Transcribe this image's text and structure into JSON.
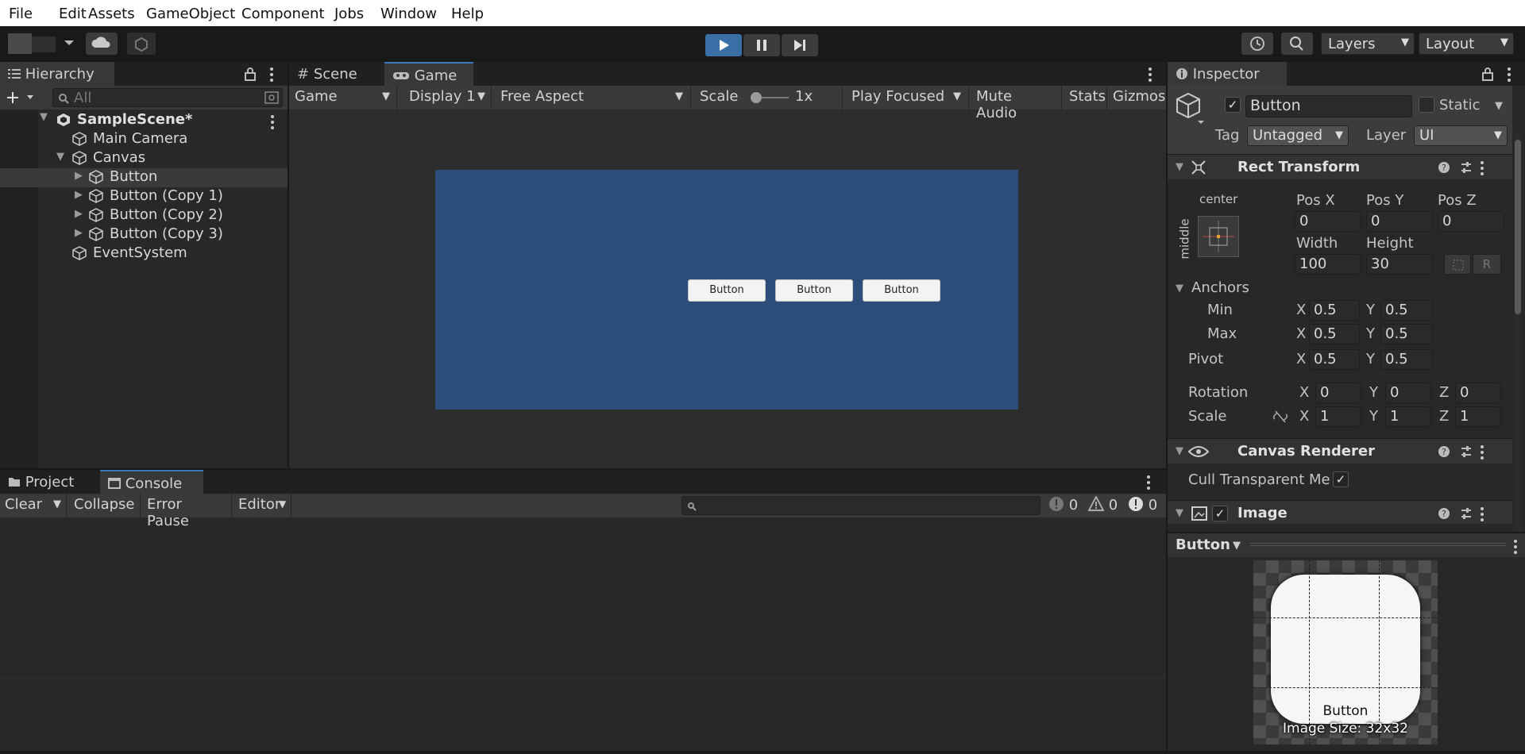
{
  "menu": [
    "File",
    "Edit",
    "Assets",
    "GameObject",
    "Component",
    "Jobs",
    "Window",
    "Help"
  ],
  "toolbar": {
    "layers_label": "Layers",
    "layout_label": "Layout"
  },
  "hierarchy": {
    "tab": "Hierarchy",
    "search_placeholder": "All",
    "scene": "SampleScene*",
    "items": [
      "Main Camera",
      "Canvas",
      "Button",
      "Button (Copy 1)",
      "Button (Copy 2)",
      "Button (Copy 3)",
      "EventSystem"
    ]
  },
  "center_tabs": {
    "scene": "Scene",
    "game": "Game"
  },
  "game_bar": {
    "game": "Game",
    "display": "Display 1",
    "aspect": "Free Aspect",
    "scale_label": "Scale",
    "scale_value": "1x",
    "play_focused": "Play Focused",
    "mute": "Mute Audio",
    "stats": "Stats",
    "gizmos": "Gizmos"
  },
  "game_view": {
    "background": "#2d4e7a",
    "buttons": [
      "Button",
      "Button",
      "Button"
    ]
  },
  "bottom_tabs": {
    "project": "Project",
    "console": "Console"
  },
  "console": {
    "clear": "Clear",
    "collapse": "Collapse",
    "error_pause": "Error Pause",
    "editor": "Editor",
    "counts": [
      "0",
      "0",
      "0"
    ]
  },
  "inspector": {
    "tab": "Inspector",
    "name": "Button",
    "static": "Static",
    "tag_label": "Tag",
    "tag_value": "Untagged",
    "layer_label": "Layer",
    "layer_value": "UI",
    "rect_transform": {
      "title": "Rect Transform",
      "anchor_h": "center",
      "anchor_v": "middle",
      "posx_label": "Pos X",
      "posy_label": "Pos Y",
      "posz_label": "Pos Z",
      "posx": "0",
      "posy": "0",
      "posz": "0",
      "width_label": "Width",
      "height_label": "Height",
      "width": "100",
      "height": "30",
      "r_btn": "R",
      "anchors": "Anchors",
      "min": "Min",
      "max": "Max",
      "pivot": "Pivot",
      "x": "X",
      "y": "Y",
      "z": "Z",
      "min_x": "0.5",
      "min_y": "0.5",
      "max_x": "0.5",
      "max_y": "0.5",
      "pivot_x": "0.5",
      "pivot_y": "0.5",
      "rotation": "Rotation",
      "rot_x": "0",
      "rot_y": "0",
      "rot_z": "0",
      "scale": "Scale",
      "scale_x": "1",
      "scale_y": "1",
      "scale_z": "1"
    },
    "canvas_renderer": {
      "title": "Canvas Renderer",
      "cull": "Cull Transparent Me"
    },
    "image": {
      "title": "Image"
    },
    "preview": {
      "name": "Button",
      "caption": "Button",
      "size": "Image Size: 32x32"
    }
  }
}
